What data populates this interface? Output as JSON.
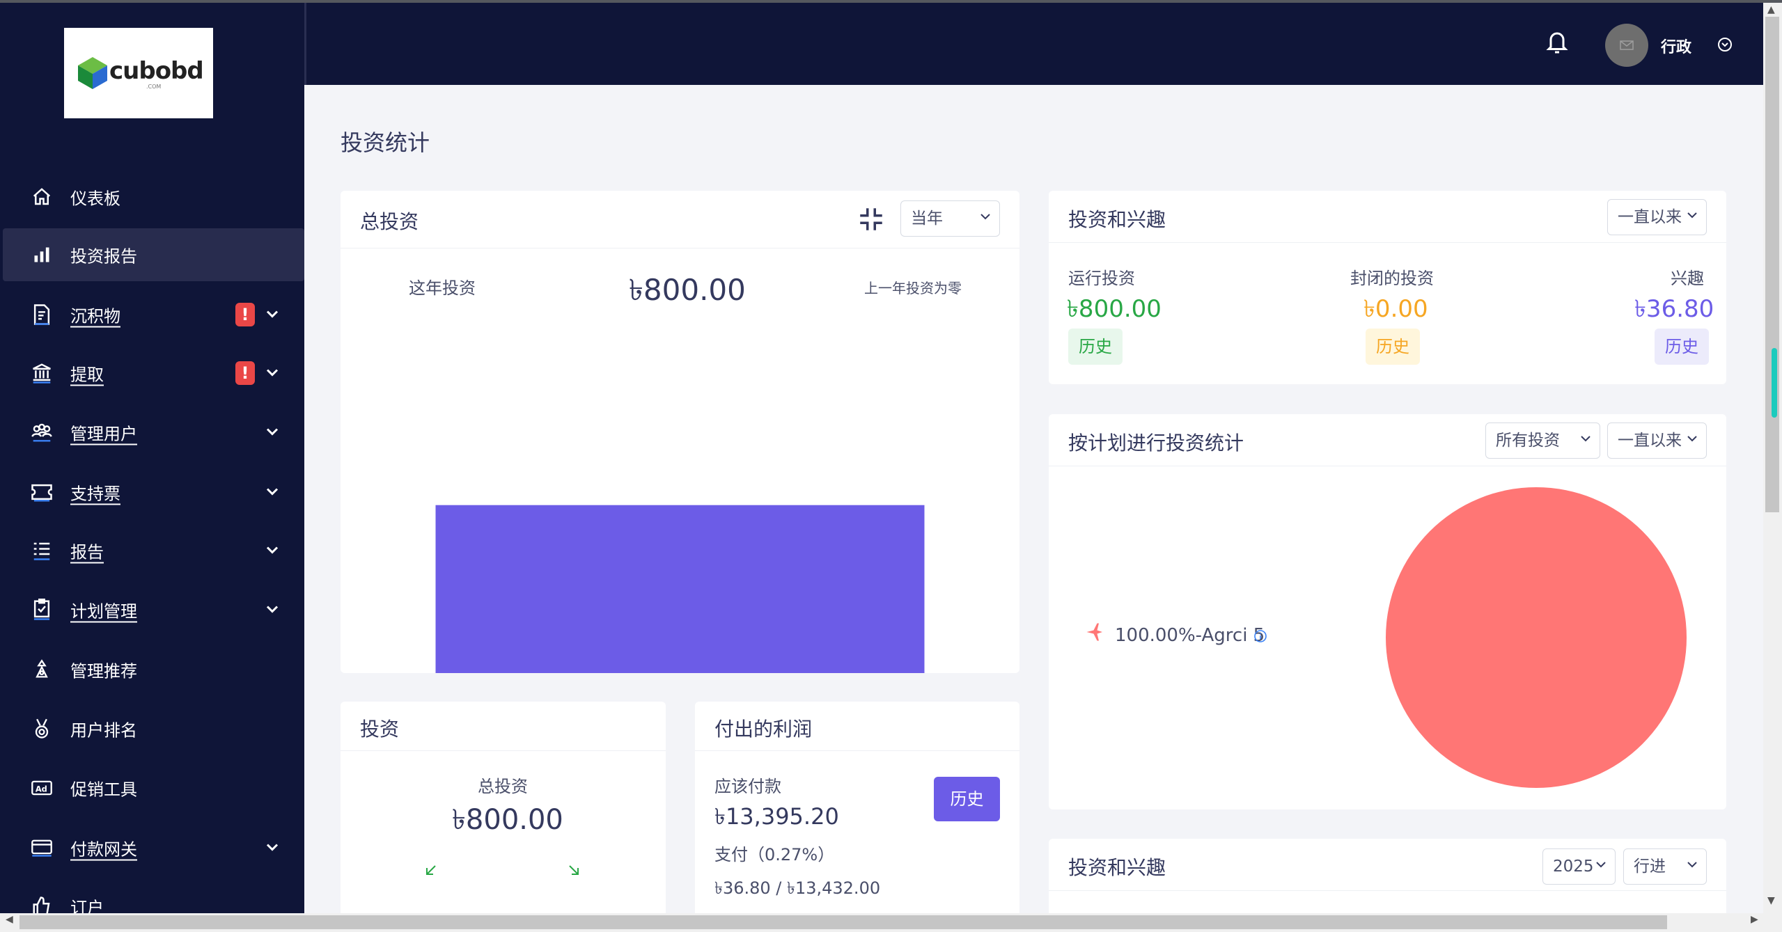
{
  "brand": {
    "logo_text": "cubobd",
    "logo_sub": ".COM"
  },
  "sidebar": {
    "items": [
      {
        "label": "仪表板",
        "icon": "home-icon"
      },
      {
        "label": "投资报告",
        "icon": "bar-chart-icon"
      },
      {
        "label": "沉积物",
        "icon": "deposit-icon",
        "badge": "!"
      },
      {
        "label": "提取",
        "icon": "bank-icon",
        "badge": "!"
      },
      {
        "label": "管理用户",
        "icon": "users-icon"
      },
      {
        "label": "支持票",
        "icon": "ticket-icon"
      },
      {
        "label": "报告",
        "icon": "list-icon"
      },
      {
        "label": "计划管理",
        "icon": "clipboard-icon"
      },
      {
        "label": "管理推荐",
        "icon": "referral-icon"
      },
      {
        "label": "用户排名",
        "icon": "medal-icon"
      },
      {
        "label": "促销工具",
        "icon": "ad-icon"
      },
      {
        "label": "付款网关",
        "icon": "credit-card-icon"
      },
      {
        "label": "订户",
        "icon": "thumbs-up-icon"
      }
    ]
  },
  "header": {
    "user_name": "行政"
  },
  "page": {
    "title": "投资统计"
  },
  "total_investment": {
    "title": "总投资",
    "period": "当年",
    "this_year_label": "这年投资",
    "this_year_value": "৳800.00",
    "last_year_note": "上一年投资为零"
  },
  "chart_data": {
    "type": "bar",
    "categories": [
      ""
    ],
    "values": [
      800
    ],
    "color": "#6c5ce7"
  },
  "invest_interest": {
    "title": "投资和兴趣",
    "period": "一直以来",
    "running_label": "运行投资",
    "running_value": "৳800.00",
    "running_color": "#28a745",
    "closed_label": "封闭的投资",
    "closed_value": "৳0.00",
    "closed_color": "#f6a623",
    "interest_label": "兴趣",
    "interest_value": "৳36.80",
    "interest_color": "#6c5ce7",
    "history_label": "历史"
  },
  "plan_stats": {
    "title": "按计划进行投资统计",
    "filter1": "所有投资",
    "filter2": "一直以来",
    "legend": "100.00%-Agrci 5",
    "pie_color": "#ff7675",
    "pie_data": [
      {
        "name": "Agrci 5",
        "percent": 100
      }
    ]
  },
  "investment_card": {
    "title": "投资",
    "total_label": "总投资",
    "total_value": "৳800.00"
  },
  "profit_card": {
    "title": "付出的利润",
    "payable_label": "应该付款",
    "payable_value": "৳13,395.20",
    "history_label": "历史",
    "paid_label": "支付（0.27%）",
    "paid_value": "৳36.80 / ৳13,432.00"
  },
  "invest_interest2": {
    "title": "投资和兴趣",
    "year": "2025",
    "mode": "行进"
  }
}
